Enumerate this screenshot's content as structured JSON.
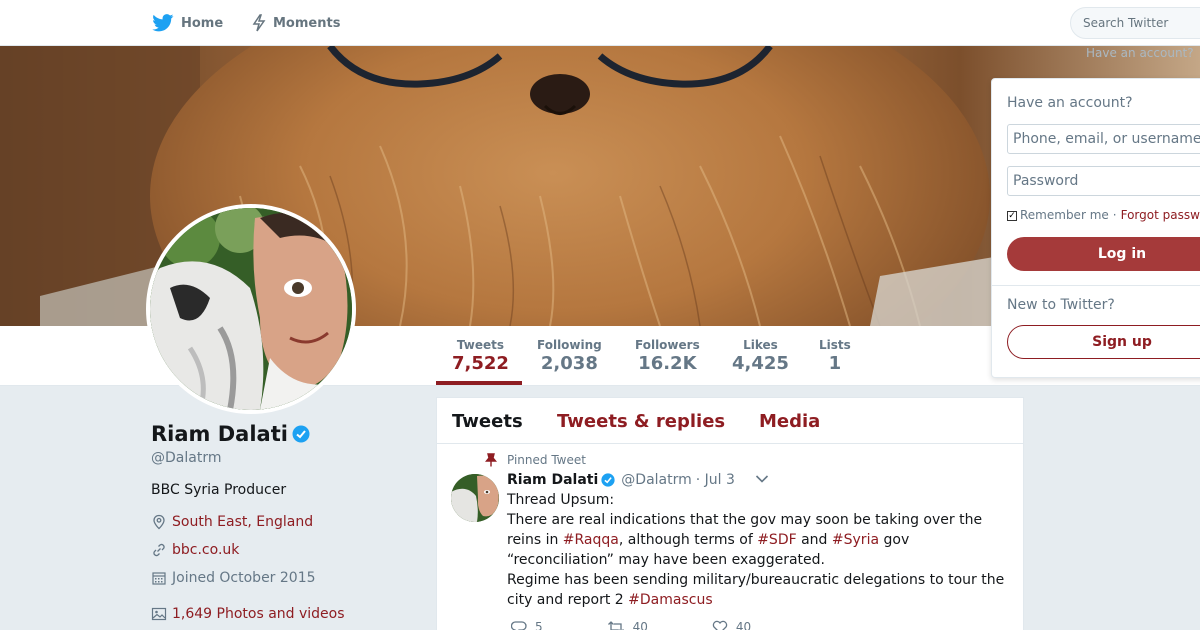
{
  "nav": {
    "home_label": "Home",
    "moments_label": "Moments",
    "search_placeholder": "Search Twitter",
    "have_account_link": "Have an account?"
  },
  "colors": {
    "brand_twitter_blue": "#1da1f2",
    "profile_link_color": "#8e1d22",
    "login_button_color": "#a53a3a",
    "verified_blue": "#1da1f2"
  },
  "profile": {
    "name": "Riam Dalati",
    "handle": "@Dalatrm",
    "bio": "BBC Syria Producer",
    "location": "South East, England",
    "website": "bbc.co.uk",
    "joined": "Joined October 2015",
    "photos_videos": "1,649 Photos and videos",
    "verified": true
  },
  "stats": [
    {
      "label": "Tweets",
      "value": "7,522",
      "active": true
    },
    {
      "label": "Following",
      "value": "2,038",
      "active": false
    },
    {
      "label": "Followers",
      "value": "16.2K",
      "active": false
    },
    {
      "label": "Likes",
      "value": "4,425",
      "active": false
    },
    {
      "label": "Lists",
      "value": "1",
      "active": false
    }
  ],
  "timeline": {
    "tabs": [
      {
        "label": "Tweets",
        "active": true
      },
      {
        "label": "Tweets & replies",
        "active": false
      },
      {
        "label": "Media",
        "active": false
      }
    ],
    "pinned_tweet": {
      "pinned_label": "Pinned Tweet",
      "author_name": "Riam Dalati",
      "author_handle": "@Dalatrm",
      "date": "· Jul 3",
      "lines": {
        "l1": "Thread Upsum:",
        "l2": "There are real indications that the gov may soon be taking over the",
        "l3a": "reins in ",
        "l3_tag1": "#Raqqa",
        "l3b": ", although terms of ",
        "l3_tag2": "#SDF",
        "l3c": " and ",
        "l3_tag3": "#Syria",
        "l3d": " gov",
        "l4": "“reconciliation” may have been exaggerated.",
        "l5": "Regime has been sending military/bureaucratic delegations to tour the",
        "l6a": "city and report 2 ",
        "l6_tag": "#Damascus"
      },
      "reply_count": "5",
      "retweet_count": "40",
      "like_count": "40"
    }
  },
  "login": {
    "title": "Have an account?",
    "username_placeholder": "Phone, email, or username",
    "password_placeholder": "Password",
    "remember_me": "Remember me",
    "separator": "·",
    "forgot_password": "Forgot password?",
    "login_button": "Log in",
    "new_to_twitter": "New to Twitter?",
    "signup_button": "Sign up"
  }
}
